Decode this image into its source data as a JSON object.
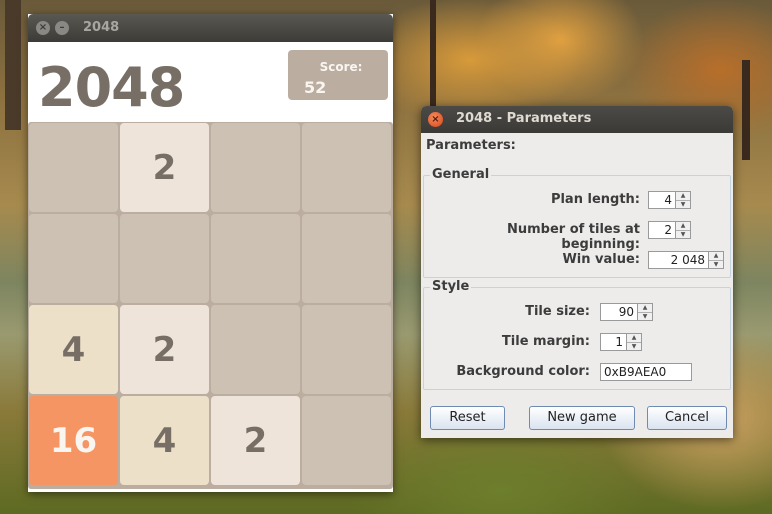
{
  "game_window": {
    "title": "2048",
    "close_glyph": "×",
    "minimize_glyph": "–",
    "heading": "2048",
    "score_label": "Score:",
    "score_value": "52",
    "board": [
      [
        "",
        "2",
        "",
        ""
      ],
      [
        "",
        "",
        "",
        ""
      ],
      [
        "4",
        "2",
        "",
        ""
      ],
      [
        "16",
        "4",
        "2",
        ""
      ]
    ]
  },
  "dialog": {
    "title": "2048 - Parameters",
    "close_glyph": "×",
    "parameters_label": "Parameters:",
    "general": {
      "title": "General",
      "plan_length_label": "Plan length:",
      "plan_length_value": "4",
      "tiles_label": "Number of tiles at beginning:",
      "tiles_value": "2",
      "win_label": "Win value:",
      "win_value": "2 048"
    },
    "style": {
      "title": "Style",
      "tile_size_label": "Tile size:",
      "tile_size_value": "90",
      "tile_margin_label": "Tile margin:",
      "tile_margin_value": "1",
      "bg_color_label": "Background color:",
      "bg_color_value": "0xB9AEA0"
    },
    "buttons": {
      "reset": "Reset",
      "new_game": "New game",
      "cancel": "Cancel"
    }
  },
  "colors": {
    "board_bg": "#bbada0",
    "empty_tile": "#cdc1b4",
    "tile_2": "#eee4da",
    "tile_4": "#ede0c8",
    "tile_16": "#f59563"
  }
}
